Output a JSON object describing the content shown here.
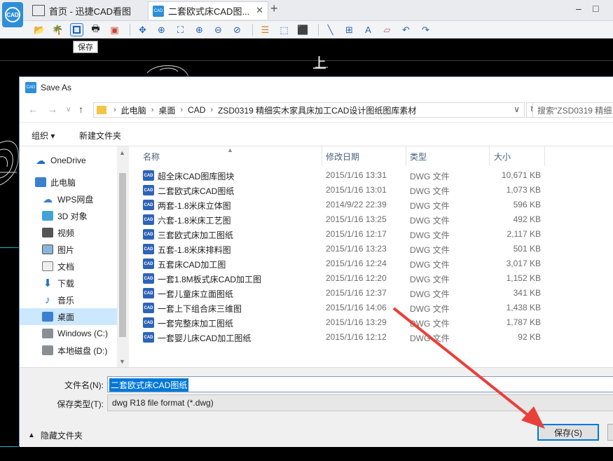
{
  "app": {
    "logo_text": "CAD",
    "home_tab_label": "首页 - 迅捷CAD看图",
    "file_tab_label": "二套欧式床CAD图...",
    "file_tab_icon_text": "CAD",
    "new_tab": "+",
    "minimize": "‒",
    "maximize": "□"
  },
  "tooltip": "保存",
  "canvas": {
    "drawing_text": "上"
  },
  "dialog": {
    "title": "Save As",
    "title_icon_text": "CAD",
    "breadcrumb": [
      "此电脑",
      "桌面",
      "CAD",
      "ZSD0319  精细实木家具床加工CAD设计图纸图库素材"
    ],
    "search_placeholder": "搜索\"ZSD0319  精细",
    "commands": {
      "organize": "组织 ▾",
      "new_folder": "新建文件夹"
    },
    "nav_items": [
      {
        "label": "OneDrive",
        "icon": "cloud-icon"
      },
      {
        "label": "此电脑",
        "icon": "computer-icon"
      },
      {
        "label": "WPS网盘",
        "icon": "cloud-icon"
      },
      {
        "label": "3D 对象",
        "icon": "cube-icon"
      },
      {
        "label": "视频",
        "icon": "video-icon"
      },
      {
        "label": "图片",
        "icon": "picture-icon"
      },
      {
        "label": "文档",
        "icon": "document-icon"
      },
      {
        "label": "下载",
        "icon": "download-icon"
      },
      {
        "label": "音乐",
        "icon": "music-icon"
      },
      {
        "label": "桌面",
        "icon": "desktop-icon"
      },
      {
        "label": "Windows (C:)",
        "icon": "drive-icon"
      },
      {
        "label": "本地磁盘 (D:)",
        "icon": "drive-icon"
      }
    ],
    "columns": {
      "name": "名称",
      "modified": "修改日期",
      "type": "类型",
      "size": "大小"
    },
    "files": [
      {
        "name": "超全床CAD图库图块",
        "modified": "2015/1/16 13:31",
        "type": "DWG 文件",
        "size": "10,671 KB"
      },
      {
        "name": "二套欧式床CAD图纸",
        "modified": "2015/1/16 13:01",
        "type": "DWG 文件",
        "size": "1,073 KB"
      },
      {
        "name": "两套-1.8米床立体图",
        "modified": "2014/9/22 22:39",
        "type": "DWG 文件",
        "size": "596 KB"
      },
      {
        "name": "六套-1.8米床工艺图",
        "modified": "2015/1/16 13:25",
        "type": "DWG 文件",
        "size": "492 KB"
      },
      {
        "name": "三套欧式床加工图纸",
        "modified": "2015/1/16 12:17",
        "type": "DWG 文件",
        "size": "2,117 KB"
      },
      {
        "name": "五套-1.8米床排料图",
        "modified": "2015/1/16 13:23",
        "type": "DWG 文件",
        "size": "501 KB"
      },
      {
        "name": "五套床CAD加工图",
        "modified": "2015/1/16 12:24",
        "type": "DWG 文件",
        "size": "3,017 KB"
      },
      {
        "name": "一套1.8M板式床CAD加工图",
        "modified": "2015/1/16 12:20",
        "type": "DWG 文件",
        "size": "1,152 KB"
      },
      {
        "name": "一套儿童床立面图纸",
        "modified": "2015/1/16 12:37",
        "type": "DWG 文件",
        "size": "341 KB"
      },
      {
        "name": "一套上下组合床三维图",
        "modified": "2015/1/16 14:06",
        "type": "DWG 文件",
        "size": "1,438 KB"
      },
      {
        "name": "一套完整床加工图纸",
        "modified": "2015/1/16 13:29",
        "type": "DWG 文件",
        "size": "1,787 KB"
      },
      {
        "name": "一套婴儿床CAD加工图纸",
        "modified": "2015/1/16 12:12",
        "type": "DWG 文件",
        "size": "92 KB"
      }
    ],
    "file_icon_text": "CAD",
    "filename_label": "文件名(N):",
    "filename_value": "二套欧式床CAD图纸",
    "filetype_label": "保存类型(T):",
    "filetype_value": "dwg R18 file format (*.dwg)",
    "hide_folders": "隐藏文件夹",
    "save_button": "保存(S)"
  },
  "colors": {
    "accent": "#0078d7",
    "arrow": "#e8403a",
    "dialog_border": "#6f8fb3"
  }
}
